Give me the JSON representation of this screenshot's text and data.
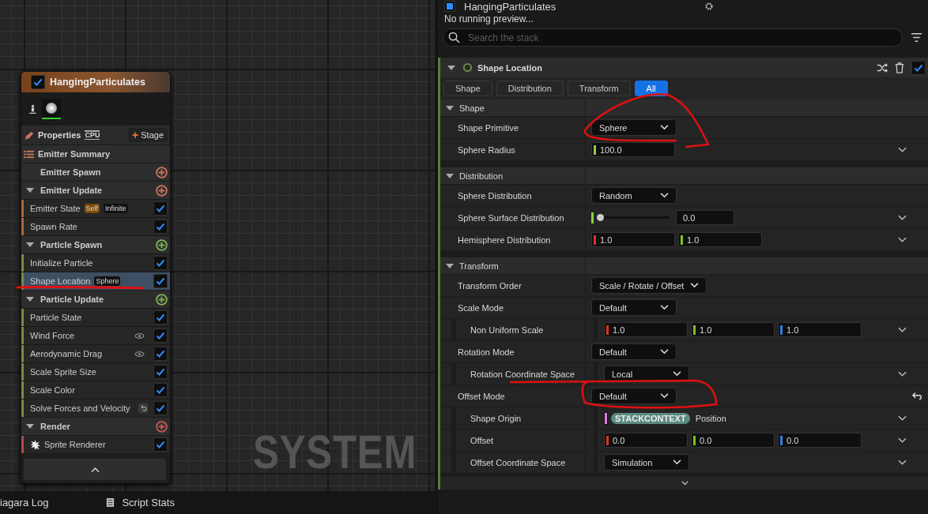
{
  "graph": {
    "watermark": "SYSTEM"
  },
  "emitter_node": {
    "title": "HangingParticulates",
    "enabled": true,
    "properties_label": "Properties",
    "sim_target": "CPU",
    "stage_icon": "+",
    "stage_button": "Stage",
    "rows": [
      {
        "kind": "summary",
        "label": "Emitter Summary"
      },
      {
        "kind": "group",
        "label": "Emitter Spawn",
        "collapsible": false,
        "color": "#c8735a"
      },
      {
        "kind": "group",
        "label": "Emitter Update",
        "collapsible": true,
        "color": "#c8735a"
      },
      {
        "kind": "module",
        "label": "Emitter State",
        "color": "#a8683f",
        "checked": true,
        "selected": false,
        "tags": [
          {
            "text": "Self",
            "kind": "highlight"
          },
          {
            "text": "Infinite",
            "kind": "plain"
          }
        ]
      },
      {
        "kind": "module",
        "label": "Spawn Rate",
        "color": "#a8683f",
        "checked": true,
        "selected": false
      },
      {
        "kind": "group",
        "label": "Particle Spawn",
        "collapsible": true,
        "color": "#7fb04f"
      },
      {
        "kind": "module",
        "label": "Initialize Particle",
        "color": "#6f8f45",
        "checked": true,
        "selected": false
      },
      {
        "kind": "module",
        "label": "Shape Location",
        "color": "#6f8f45",
        "checked": true,
        "selected": true,
        "tags": [
          {
            "text": "Sphere",
            "kind": "plain"
          }
        ]
      },
      {
        "kind": "group",
        "label": "Particle Update",
        "collapsible": true,
        "color": "#7fb04f"
      },
      {
        "kind": "module",
        "label": "Particle State",
        "color": "#6f8f45",
        "checked": true,
        "selected": false
      },
      {
        "kind": "visibility-module",
        "label": "Wind Force",
        "color": "#6f8f45",
        "checked": true,
        "selected": false
      },
      {
        "kind": "visibility-module",
        "label": "Aerodynamic Drag",
        "color": "#6f8f45",
        "checked": true,
        "selected": false
      },
      {
        "kind": "module",
        "label": "Scale Sprite Size",
        "color": "#6f8f45",
        "checked": true,
        "selected": false
      },
      {
        "kind": "module",
        "label": "Scale Color",
        "color": "#6f8f45",
        "checked": true,
        "selected": false
      },
      {
        "kind": "resettable-module",
        "label": "Solve Forces and Velocity",
        "color": "#6f8f45",
        "checked": true,
        "selected": false
      },
      {
        "kind": "group",
        "label": "Render",
        "collapsible": true,
        "color": "#c05a5a"
      },
      {
        "kind": "renderer",
        "label": "Sprite Renderer",
        "color": "#b04a4a",
        "checked": true,
        "selected": false
      }
    ]
  },
  "stack": {
    "title": "HangingParticulates",
    "enabled": true,
    "status": "No running preview...",
    "search": {
      "placeholder": "Search the stack"
    },
    "module": {
      "title": "Shape Location",
      "expanded": true,
      "enabled": true,
      "tabs": [
        {
          "label": "Shape",
          "selected": false
        },
        {
          "label": "Distribution",
          "selected": false
        },
        {
          "label": "Transform",
          "selected": false
        },
        {
          "label": "All",
          "selected": true
        }
      ],
      "sections": [
        {
          "title": "Shape",
          "expanded": true,
          "rows": [
            {
              "kind": "dropdown",
              "label": "Shape Primitive",
              "value": "Sphere"
            },
            {
              "kind": "number",
              "label": "Sphere Radius",
              "value": "100.0",
              "color": "#8fd13f",
              "expanded": false
            }
          ]
        },
        {
          "title": "Distribution",
          "expanded": true,
          "rows": [
            {
              "kind": "dropdown",
              "label": "Sphere Distribution",
              "value": "Random"
            },
            {
              "kind": "slider",
              "label": "Sphere Surface Distribution",
              "level": 0,
              "value": "0.0",
              "color": "#8fd13f",
              "expanded": false
            },
            {
              "kind": "vector",
              "label": "Hemisphere Distribution",
              "components": [
                {
                  "value": "1.0",
                  "color": "#e0321e"
                },
                {
                  "value": "1.0",
                  "color": "#7fc31c"
                }
              ],
              "expanded": false
            }
          ]
        },
        {
          "title": "Transform",
          "expanded": true,
          "rows": [
            {
              "kind": "dropdown",
              "label": "Transform Order",
              "value": "Scale / Rotate / Offset"
            },
            {
              "kind": "dropdown",
              "label": "Scale Mode",
              "value": "Default",
              "children": [
                {
                  "kind": "vector",
                  "label": "Non Uniform Scale",
                  "components": [
                    {
                      "value": "1.0",
                      "color": "#e0321e"
                    },
                    {
                      "value": "1.0",
                      "color": "#7fc31c"
                    },
                    {
                      "value": "1.0",
                      "color": "#2f7de8"
                    }
                  ],
                  "expanded": false
                }
              ]
            },
            {
              "kind": "dropdown",
              "label": "Rotation Mode",
              "value": "Default",
              "children": [
                {
                  "kind": "dropdown",
                  "label": "Rotation Coordinate Space",
                  "value": "Local",
                  "expanded": false
                }
              ]
            },
            {
              "kind": "dropdown",
              "label": "Offset Mode",
              "value": "Default",
              "modified": true,
              "children": [
                {
                  "kind": "binding",
                  "label": "Shape Origin",
                  "namespace": "STACKCONTEXT",
                  "value": "Position",
                  "color": "#e07be0",
                  "expanded": false
                },
                {
                  "kind": "vector",
                  "label": "Offset",
                  "components": [
                    {
                      "value": "0.0",
                      "color": "#e0321e"
                    },
                    {
                      "value": "0.0",
                      "color": "#7fc31c"
                    },
                    {
                      "value": "0.0",
                      "color": "#2f7de8"
                    }
                  ],
                  "expanded": false
                },
                {
                  "kind": "dropdown",
                  "label": "Offset Coordinate Space",
                  "value": "Simulation",
                  "expanded": false
                }
              ]
            }
          ]
        }
      ]
    }
  },
  "bottom_tabs": [
    {
      "label": "iagara Log",
      "kind": "log"
    },
    {
      "label": "Script Stats",
      "kind": "stats"
    }
  ],
  "annotations": [
    {
      "kind": "underline"
    },
    {
      "kind": "loop"
    },
    {
      "kind": "loop"
    }
  ]
}
